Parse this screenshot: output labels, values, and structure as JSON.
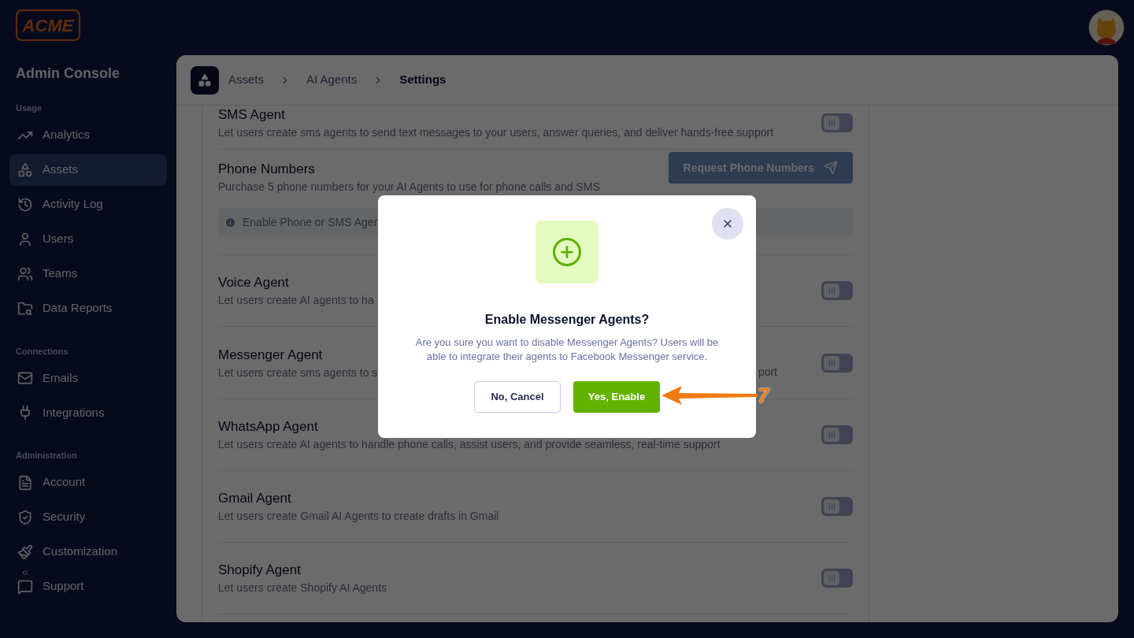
{
  "brand": {
    "logo": "ACME",
    "title": "Admin Console"
  },
  "sidebar": {
    "sections": [
      {
        "heading": "Usage",
        "items": [
          {
            "label": "Analytics",
            "selected": false
          },
          {
            "label": "Assets",
            "selected": true
          },
          {
            "label": "Activity Log",
            "selected": false
          },
          {
            "label": "Users",
            "selected": false
          },
          {
            "label": "Teams",
            "selected": false
          },
          {
            "label": "Data Reports",
            "selected": false
          }
        ]
      },
      {
        "heading": "Connections",
        "items": [
          {
            "label": "Emails",
            "selected": false
          },
          {
            "label": "Integrations",
            "selected": false
          }
        ]
      },
      {
        "heading": "Administration",
        "items": [
          {
            "label": "Account",
            "selected": false
          },
          {
            "label": "Security",
            "selected": false
          },
          {
            "label": "Customization",
            "selected": false
          },
          {
            "label": "Support",
            "selected": false
          }
        ]
      }
    ]
  },
  "breadcrumbs": [
    {
      "label": "Assets",
      "current": false
    },
    {
      "label": "AI Agents",
      "current": false
    },
    {
      "label": "Settings",
      "current": true
    }
  ],
  "settings": [
    {
      "kind": "toggle",
      "title": "SMS Agent",
      "description": "Let users create sms agents to send text messages to your users, answer queries, and deliver hands-free support",
      "on": false
    },
    {
      "kind": "action",
      "title": "Phone Numbers",
      "description": "Purchase 5 phone numbers for your AI Agents to use for phone calls and SMS",
      "button": "Request Phone Numbers",
      "notice": "Enable Phone or SMS Agen"
    },
    {
      "kind": "toggle",
      "title": "Voice Agent",
      "description": "Let users create AI agents to ha",
      "on": false
    },
    {
      "kind": "toggle",
      "title": "Messenger Agent",
      "description": "Let users create sms agents to s",
      "description_tail": "port",
      "on": false
    },
    {
      "kind": "toggle",
      "title": "WhatsApp Agent",
      "description": "Let users create AI agents to handle phone calls, assist users, and provide seamless, real-time support",
      "on": false
    },
    {
      "kind": "toggle",
      "title": "Gmail Agent",
      "description": "Let users create Gmail AI Agents to create drafts in Gmail",
      "on": false
    },
    {
      "kind": "toggle",
      "title": "Shopify Agent",
      "description": "Let users create Shopify AI Agents",
      "on": false
    }
  ],
  "dialog": {
    "title": "Enable Messenger Agents?",
    "message": "Are you sure you want to disable Messenger Agents? Users will be able to integrate their agents to Facebook Messenger service.",
    "cancel": "No, Cancel",
    "confirm": "Yes, Enable"
  },
  "callout": {
    "number": "7"
  }
}
